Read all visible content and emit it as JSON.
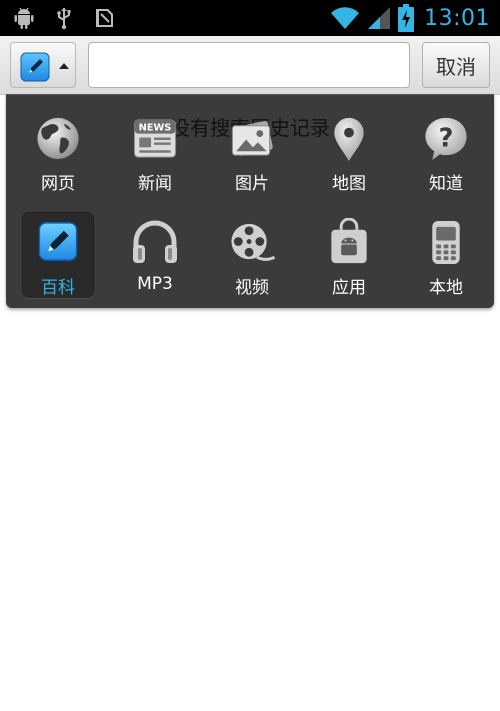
{
  "status_bar": {
    "time": "13:01",
    "left_icons": [
      "android-debug-icon",
      "usb-icon",
      "sd-card-icon"
    ],
    "right_icons": [
      "wifi-icon",
      "signal-icon",
      "battery-charging-icon"
    ],
    "accent_color": "#33b5e5"
  },
  "search": {
    "engine_icon": "baike-pencil-icon",
    "input_value": "",
    "cancel_label": "取消"
  },
  "panel": {
    "empty_message": "没有搜索历史记录",
    "categories": [
      {
        "label": "网页",
        "icon": "globe-icon",
        "selected": false
      },
      {
        "label": "新闻",
        "icon": "news-icon",
        "selected": false
      },
      {
        "label": "图片",
        "icon": "picture-icon",
        "selected": false
      },
      {
        "label": "地图",
        "icon": "map-pin-icon",
        "selected": false
      },
      {
        "label": "知道",
        "icon": "question-bubble-icon",
        "selected": false
      },
      {
        "label": "百科",
        "icon": "baike-pencil-icon",
        "selected": true
      },
      {
        "label": "MP3",
        "icon": "headphones-icon",
        "selected": false
      },
      {
        "label": "视频",
        "icon": "film-reel-icon",
        "selected": false
      },
      {
        "label": "应用",
        "icon": "android-bag-icon",
        "selected": false
      },
      {
        "label": "本地",
        "icon": "phone-icon",
        "selected": false
      }
    ],
    "selected_color": "#33b5e5"
  }
}
